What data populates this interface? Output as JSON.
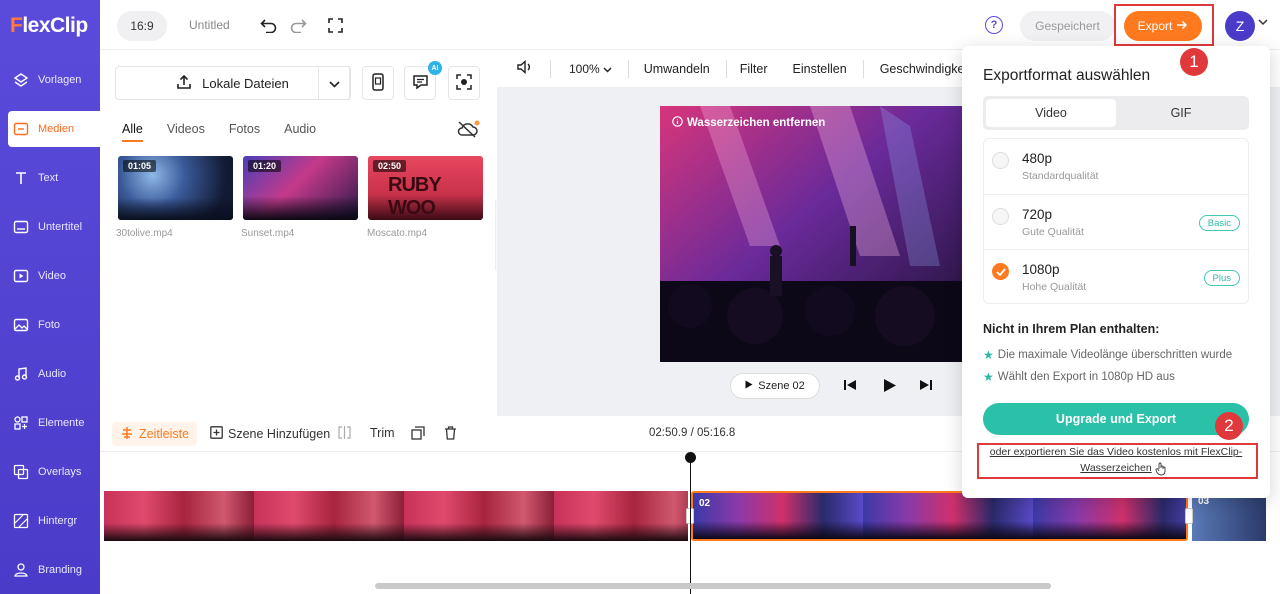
{
  "app": {
    "logo": "FlexClip"
  },
  "sidebar": {
    "items": [
      {
        "label": "Vorlagen",
        "icon": "templates-icon"
      },
      {
        "label": "Medien",
        "icon": "media-icon",
        "active": true
      },
      {
        "label": "Text",
        "icon": "text-icon"
      },
      {
        "label": "Untertitel",
        "icon": "subtitle-icon"
      },
      {
        "label": "Video",
        "icon": "video-icon"
      },
      {
        "label": "Foto",
        "icon": "photo-icon"
      },
      {
        "label": "Audio",
        "icon": "audio-icon"
      },
      {
        "label": "Elemente",
        "icon": "elements-icon"
      },
      {
        "label": "Overlays",
        "icon": "overlays-icon"
      },
      {
        "label": "Hintergr",
        "icon": "background-icon"
      },
      {
        "label": "Branding",
        "icon": "branding-icon"
      }
    ]
  },
  "topbar": {
    "ratio": "16:9",
    "title": "Untitled",
    "help": "?",
    "saved": "Gespeichert",
    "export": "Export",
    "avatar": "Z"
  },
  "media": {
    "upload_label": "Lokale Dateien",
    "ai_badge": "AI",
    "tabs": [
      "Alle",
      "Videos",
      "Fotos",
      "Audio"
    ],
    "files": [
      {
        "name": "30tolive.mp4",
        "duration": "01:05"
      },
      {
        "name": "Sunset.mp4",
        "duration": "01:20"
      },
      {
        "name": "Moscato.mp4",
        "duration": "02:50"
      }
    ]
  },
  "preview": {
    "zoom": "100%",
    "toolbar": [
      "Umwandeln",
      "Filter",
      "Einstellen",
      "Geschwindigkeit"
    ],
    "watermark": "Wasserzeichen entfernen",
    "scene_label": "Szene 02"
  },
  "timeline": {
    "tab": "Zeitleiste",
    "add_scene": "Szene Hinzufügen",
    "trim": "Trim",
    "time": "02:50.9 / 05:16.8",
    "clips": [
      "02",
      "03"
    ]
  },
  "export_panel": {
    "title": "Exportformat auswählen",
    "formats": [
      "Video",
      "GIF"
    ],
    "qualities": [
      {
        "name": "480p",
        "desc": "Standardqualität",
        "badge": ""
      },
      {
        "name": "720p",
        "desc": "Gute Qualität",
        "badge": "Basic"
      },
      {
        "name": "1080p",
        "desc": "Hohe Qualität",
        "badge": "Plus",
        "selected": true
      }
    ],
    "not_included_title": "Nicht in Ihrem Plan enthalten:",
    "features": [
      "Die maximale Videolänge überschritten wurde",
      "Wählt den Export in 1080p HD aus"
    ],
    "upgrade_label": "Upgrade und Export",
    "free_link": "oder exportieren Sie das Video kostenlos mit FlexClip-Wasserzeichen"
  },
  "annotations": {
    "step1": "1",
    "step2": "2"
  },
  "colors": {
    "brand": "#5b4bdb",
    "accent": "#ff7a1f",
    "upgrade": "#2bc0a8",
    "annotation": "#e0393c"
  }
}
